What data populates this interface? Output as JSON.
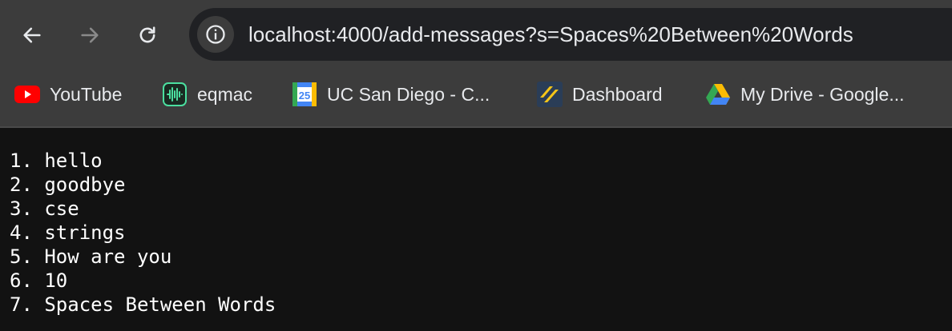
{
  "browser": {
    "url": "localhost:4000/add-messages?s=Spaces%20Between%20Words",
    "back_icon": "arrow-left-icon",
    "forward_icon": "arrow-right-icon",
    "reload_icon": "reload-icon",
    "site_info_icon": "info-circle-icon"
  },
  "bookmarks": [
    {
      "label": "YouTube",
      "icon": "youtube-icon"
    },
    {
      "label": "eqmac",
      "icon": "eqmac-icon"
    },
    {
      "label": "UC San Diego - C...",
      "icon": "calendar-icon",
      "icon_text": "25"
    },
    {
      "label": "Dashboard",
      "icon": "dashboard-icon"
    },
    {
      "label": "My Drive - Google...",
      "icon": "google-drive-icon"
    }
  ],
  "page": {
    "lines": [
      "1. hello",
      "2. goodbye",
      "3. cse",
      "4. strings",
      "5. How are you",
      "6. 10",
      "7. Spaces Between Words"
    ]
  },
  "colors": {
    "toolbar": "#3c3c3c",
    "omnibox": "#202124",
    "page_background": "#121212",
    "text": "#ffffff"
  }
}
